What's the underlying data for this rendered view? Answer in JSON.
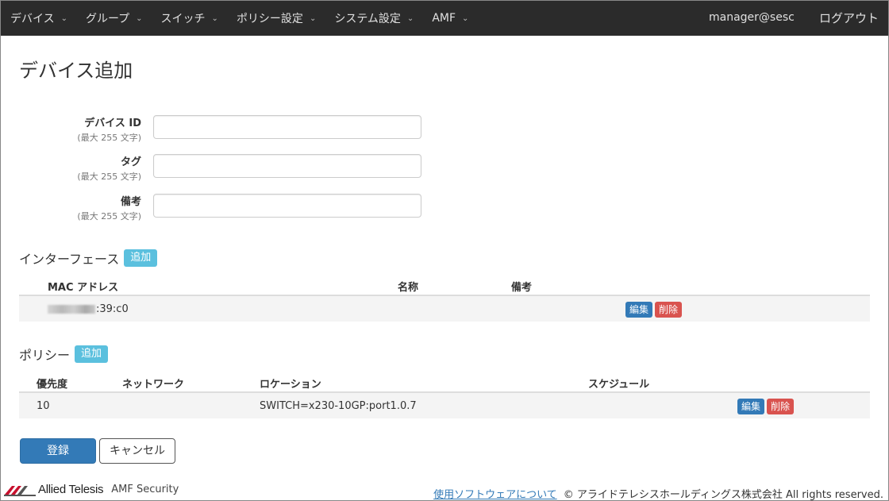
{
  "nav": {
    "items": [
      {
        "label": "デバイス"
      },
      {
        "label": "グループ"
      },
      {
        "label": "スイッチ"
      },
      {
        "label": "ポリシー設定"
      },
      {
        "label": "システム設定"
      },
      {
        "label": "AMF"
      }
    ],
    "user": "manager@sesc",
    "logout": "ログアウト"
  },
  "page": {
    "title": "デバイス追加"
  },
  "form": {
    "device_id": {
      "label": "デバイス ID",
      "hint": "(最大 255 文字)",
      "value": ""
    },
    "tag": {
      "label": "タグ",
      "hint": "(最大 255 文字)",
      "value": ""
    },
    "note": {
      "label": "備考",
      "hint": "(最大 255 文字)",
      "value": ""
    }
  },
  "interfaces": {
    "title": "インターフェース",
    "add_label": "追加",
    "columns": [
      "MAC アドレス",
      "名称",
      "備考"
    ],
    "rows": [
      {
        "mac_suffix": ":39:c0",
        "name": "",
        "note": "",
        "edit": "編集",
        "delete": "削除"
      }
    ]
  },
  "policies": {
    "title": "ポリシー",
    "add_label": "追加",
    "columns": [
      "優先度",
      "ネットワーク",
      "ロケーション",
      "スケジュール"
    ],
    "rows": [
      {
        "priority": "10",
        "network": "",
        "location": "SWITCH=x230-10GP:port1.0.7",
        "schedule": "",
        "edit": "編集",
        "delete": "削除"
      }
    ]
  },
  "actions": {
    "submit": "登録",
    "cancel": "キャンセル"
  },
  "footer": {
    "brand": "Allied Telesis",
    "product": "AMF Security",
    "software_link": "使用ソフトウェアについて",
    "copyright": "© アライドテレシスホールディングス株式会社 All rights reserved."
  }
}
